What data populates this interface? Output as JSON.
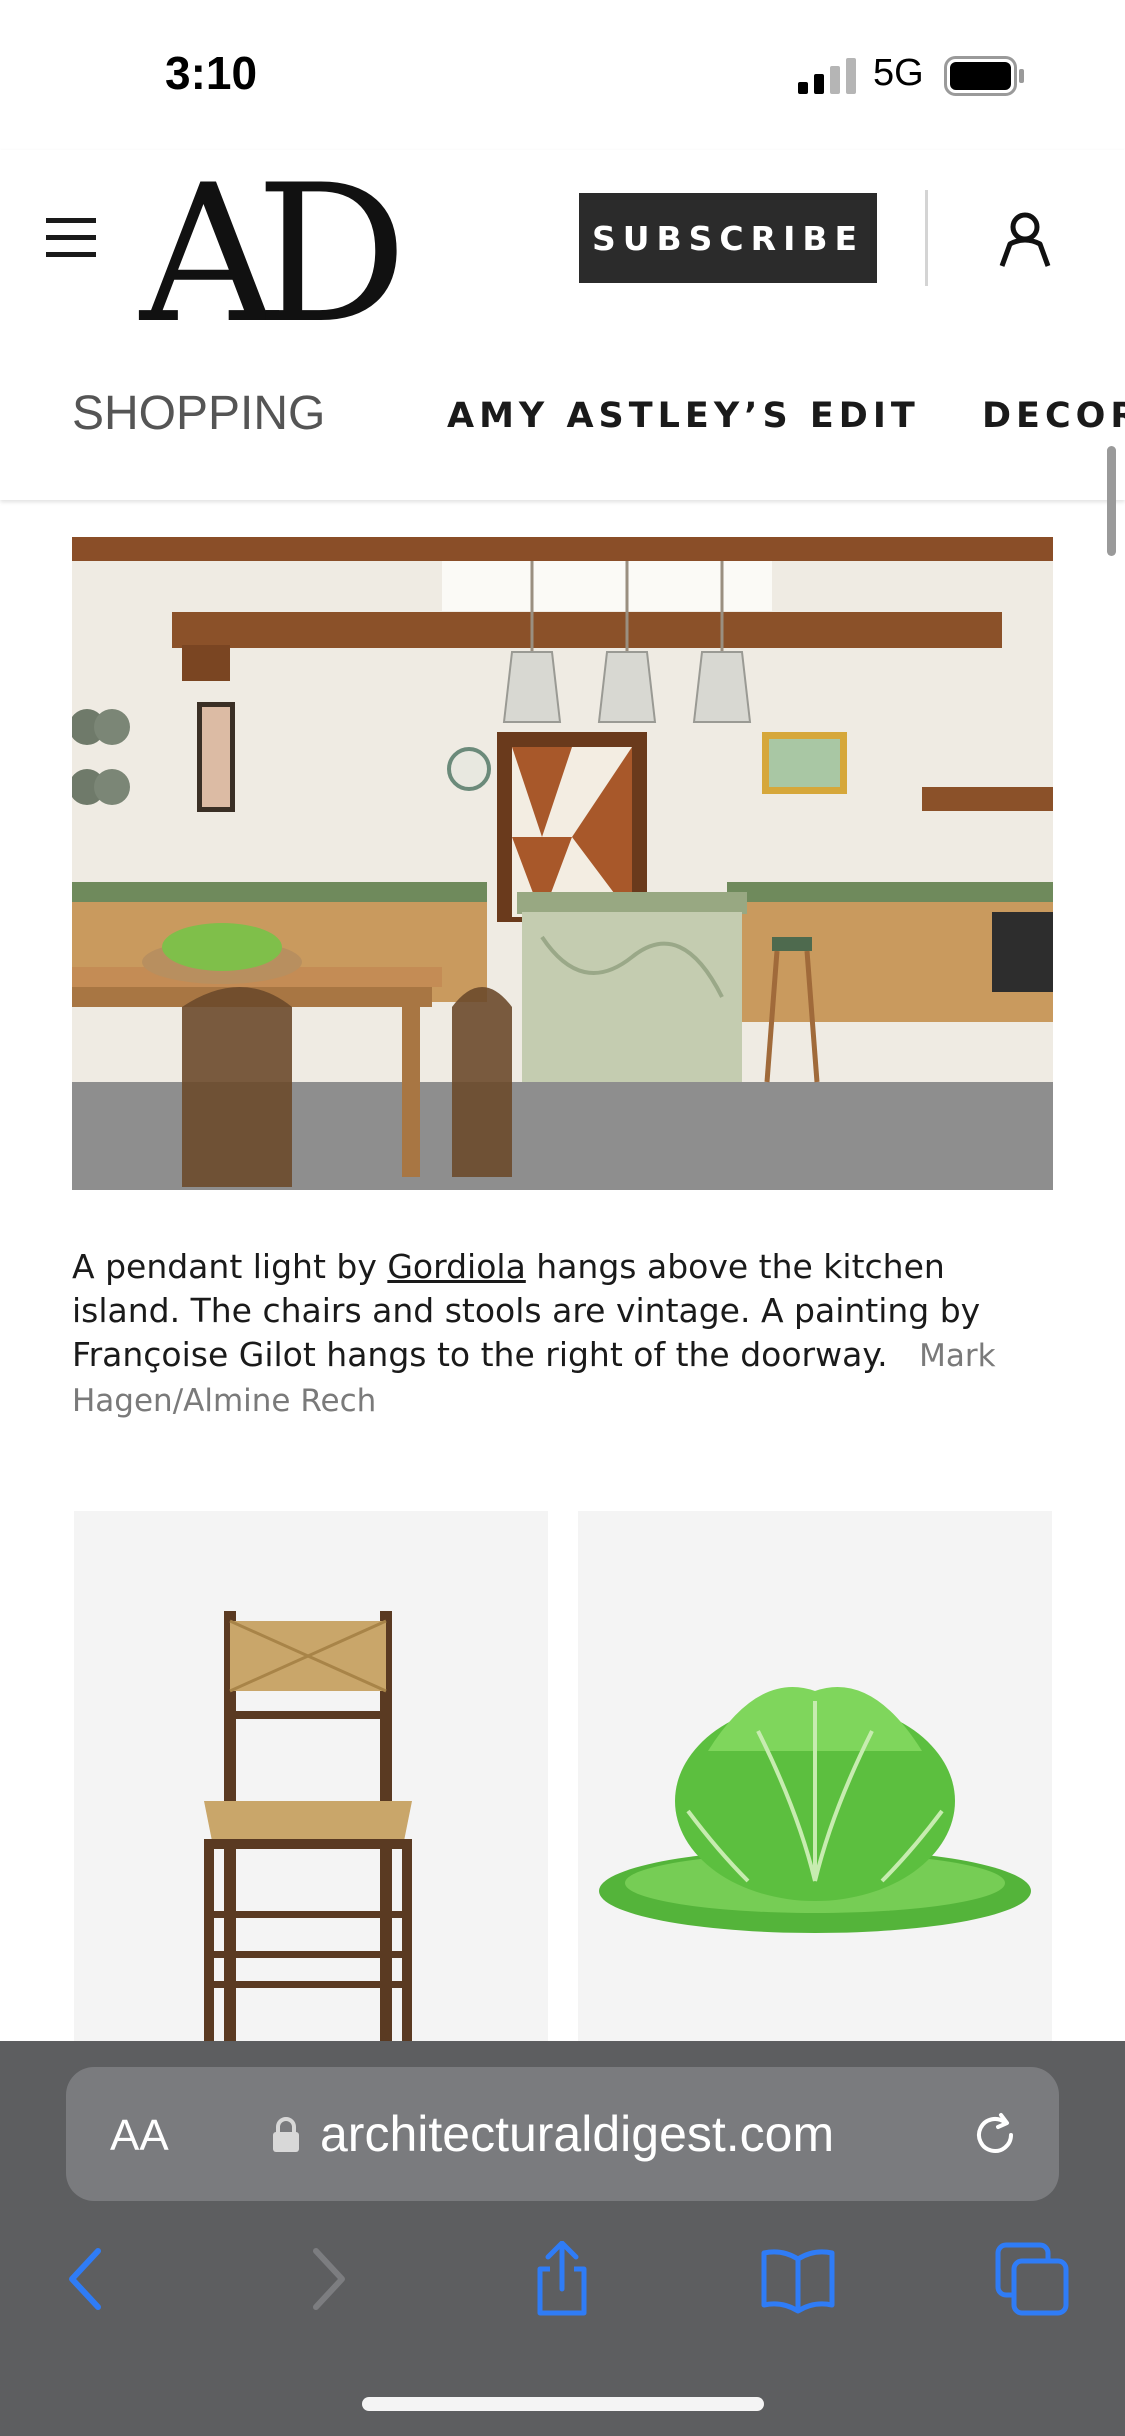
{
  "status_bar": {
    "time": "3:10",
    "network": "5G"
  },
  "header": {
    "logo": "AD",
    "subscribe_label": "SUBSCRIBE",
    "nav": {
      "current": "SHOPPING",
      "items": [
        "AMY ASTLEY’S EDIT",
        "DECOR"
      ]
    }
  },
  "article": {
    "caption_pre": "A pendant light by ",
    "caption_link": "Gordiola",
    "caption_post": " hangs above the kitchen island. The chairs and stools are vintage. A painting by Françoise Gilot hangs to the right of the doorway.",
    "credit": "Mark Hagen/Almine Rech"
  },
  "browser": {
    "aa_label": "AA",
    "url": "architecturaldigest.com"
  },
  "colors": {
    "accent_blue": "#2f7cf6",
    "toolbar_bg": "#5d5e60"
  }
}
